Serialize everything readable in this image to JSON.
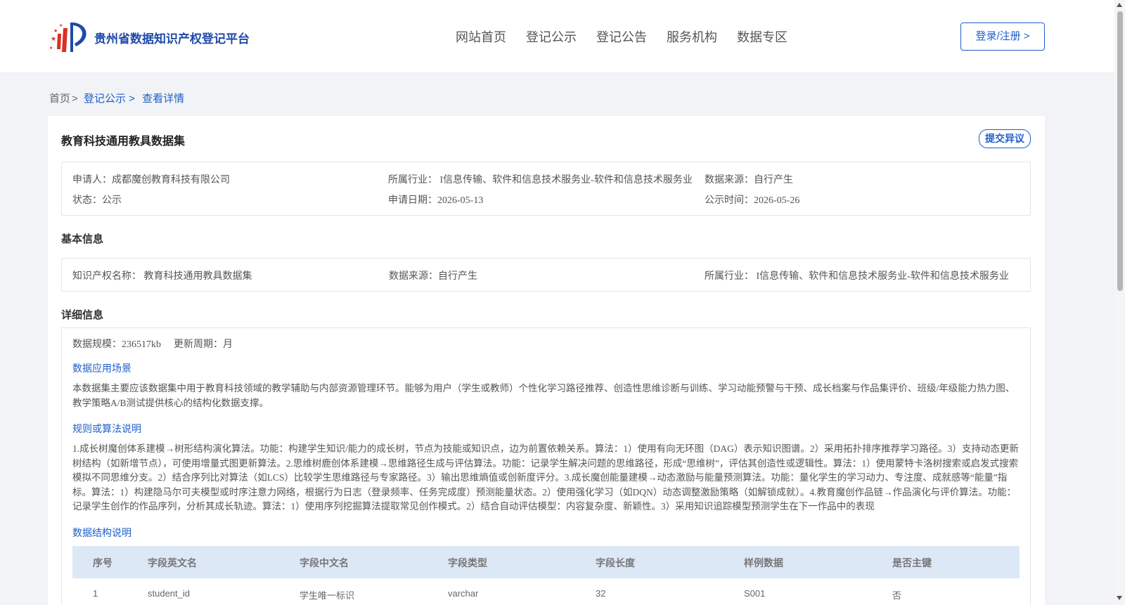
{
  "header": {
    "logo_text": "贵州省数据知识产权登记平台",
    "nav": [
      "网站首页",
      "登记公示",
      "登记公告",
      "服务机构",
      "数据专区"
    ],
    "login_label": "登录/注册 >"
  },
  "breadcrumb": {
    "home": "首页",
    "sep": ">",
    "section": "登记公示 >",
    "current": "查看详情"
  },
  "detail": {
    "title": "教育科技通用教具数据集",
    "objection_label": "提交异议",
    "summary": {
      "applicant": "申请人：成都魔创教育科技有限公司",
      "industry": "所属行业： I信息传输、软件和信息技术服务业-软件和信息技术服务业",
      "source": "数据来源：自行产生",
      "status": "状态：公示",
      "apply_date": "申请日期：2026-05-13",
      "publish_date": "公示时间：2026-05-26"
    },
    "basic_title": "基本信息",
    "basic": {
      "ip_name": "知识产权名称： 教育科技通用教具数据集",
      "source": "数据来源：自行产生",
      "industry": "所属行业： I信息传输、软件和信息技术服务业-软件和信息技术服务业"
    },
    "detail_title": "详细信息",
    "scale": "数据规模：236517kb",
    "cycle": "更新周期：月",
    "scene_label": "数据应用场景",
    "scene_text": "本数据集主要应该数据集中用于教育科技领域的教学辅助与内部资源管理环节。能够为用户（学生或教师）个性化学习路径推荐、创造性思维诊断与训练、学习动能预警与干预、成长档案与作品集评价、班级/年级能力热力图、教学策略A/B测试提供核心的结构化数据支撑。",
    "algo_label": "规则或算法说明",
    "algo_text": "1.成长树魔创体系建模→树形结构演化算法。功能：构建学生知识/能力的成长树，节点为技能或知识点，边为前置依赖关系。算法：1）使用有向无环图（DAG）表示知识图谱。2）采用拓扑排序推荐学习路径。3）支持动态更新树结构（如新增节点），可使用增量式图更新算法。2.思维树鹿创体系建模→思维路径生成与评估算法。功能：记录学生解决问题的思维路径，形成“思维树”，评估其创造性或逻辑性。算法：1）使用蒙特卡洛树搜索或启发式搜索模拟不同思维分支。2）结合序列比对算法（如LCS）比较学生思维路径与专家路径。3）输出思维熵值或创新度评分。3.成长魔创能量建模→动态激励与能量预测算法。功能：量化学生的学习动力、专注度、成就感等“能量”指标。算法：1）构建隐马尔可夫模型或时序注意力网络，根据行为日志（登录频率、任务完成度）预测能量状态。2）使用强化学习（如DQN）动态调整激励策略（如解锁成就）。4.教育魔创作品链→作品演化与评价算法。功能：记录学生创作的作品序列，分析其成长轨迹。算法：1）使用序列挖掘算法提取常见创作模式。2）结合自动评估模型：内容复杂度、新颖性。3）采用知识追踪模型预测学生在下一作品中的表现",
    "struct_label": "数据结构说明",
    "table": {
      "headers": [
        "序号",
        "字段英文名",
        "字段中文名",
        "字段类型",
        "字段长度",
        "样例数据",
        "是否主键"
      ],
      "rows": [
        [
          "1",
          "student_id",
          "学生唯一标识",
          "varchar",
          "32",
          "S001",
          "否"
        ]
      ]
    }
  }
}
